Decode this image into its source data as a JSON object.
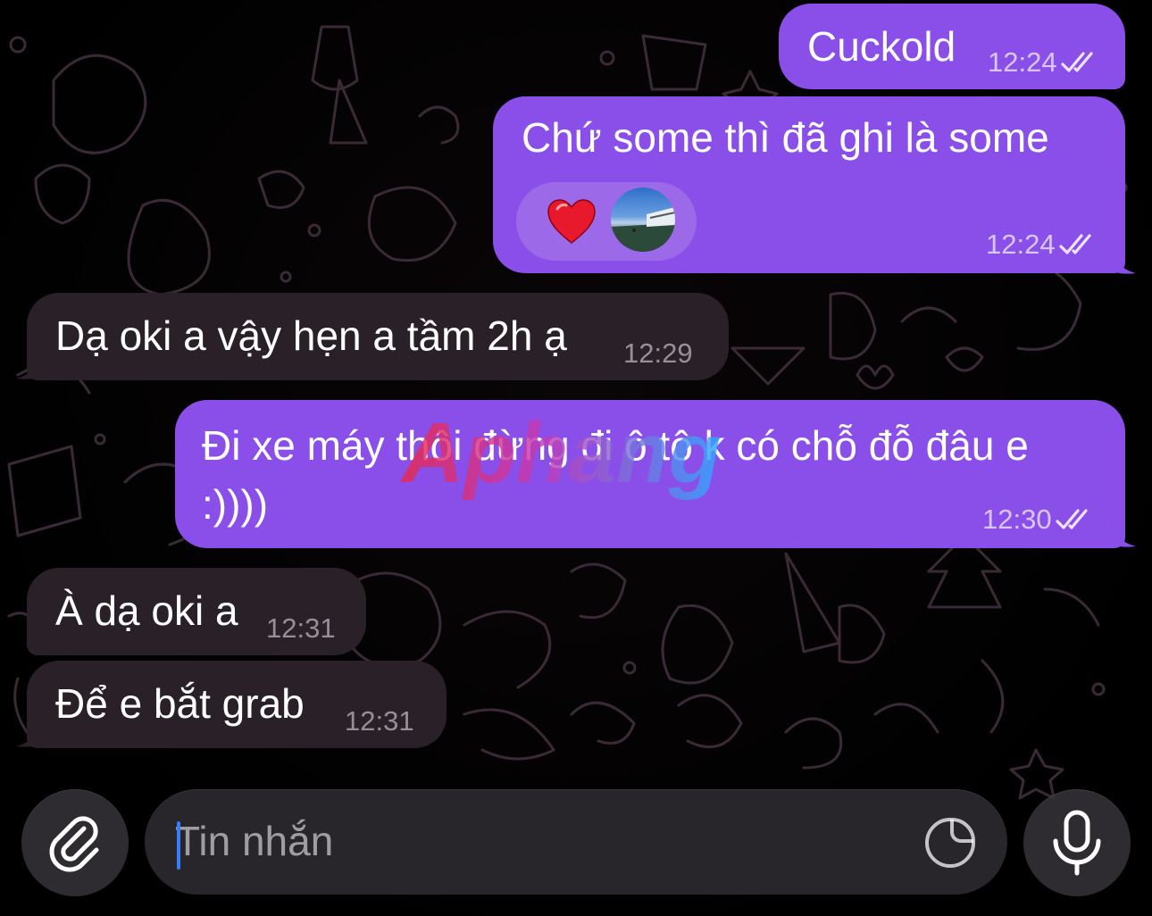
{
  "messages": [
    {
      "text": "Cuckold",
      "time": "12:24",
      "direction": "out",
      "status": "read"
    },
    {
      "text": "Chứ some thì đã ghi là some",
      "time": "12:24",
      "direction": "out",
      "status": "read",
      "reactions": [
        {
          "icon": "heart-emoji"
        },
        {
          "icon": "reactor-avatar"
        }
      ]
    },
    {
      "text": "Dạ oki a vậy hẹn a tầm 2h ạ",
      "time": "12:29",
      "direction": "in"
    },
    {
      "text": "Đi xe máy thôi đừng đi ô tô k có chỗ đỗ đâu e :))))",
      "time": "12:30",
      "direction": "out",
      "status": "read"
    },
    {
      "text": "À dạ oki a",
      "time": "12:31",
      "direction": "in"
    },
    {
      "text": "Để e bắt grab",
      "time": "12:31",
      "direction": "in"
    }
  ],
  "composer": {
    "placeholder": "Tin nhắn",
    "value": "",
    "attach_icon": "paperclip-icon",
    "sticker_icon": "sticker-icon",
    "mic_icon": "microphone-icon"
  },
  "watermark": {
    "text": "Aphang"
  },
  "colors": {
    "outgoing_bubble": "#8a4fe8",
    "incoming_bubble": "#2a2028",
    "background": "#000000",
    "accent": "#3a7bff"
  }
}
